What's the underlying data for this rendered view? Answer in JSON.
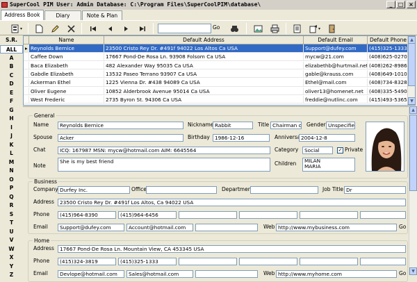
{
  "window": {
    "title": "SuperCool PIM    User: Admin  Database: C:\\Program Files\\SuperCoolPIM\\database\\"
  },
  "tabs": [
    "Address Book",
    "Diary",
    "Note & Plan"
  ],
  "toolbar": {
    "search_value": "",
    "go_label": "Go"
  },
  "az": {
    "header": "S.R.",
    "items": [
      "ALL",
      "A",
      "B",
      "C",
      "D",
      "E",
      "F",
      "G",
      "H",
      "I",
      "J",
      "K",
      "L",
      "M",
      "N",
      "O",
      "P",
      "Q",
      "R",
      "S",
      "T",
      "U",
      "V",
      "W",
      "X",
      "Y",
      "Z"
    ]
  },
  "grid": {
    "columns": [
      "Name",
      "Default Address",
      "Default Email",
      "Default Phone"
    ],
    "rows": [
      [
        "Reynolds Bernice",
        "23500 Cristo Rey Dr. #491f 94022 Los Altos Ca USA",
        "Support@dufey.com",
        "(415)325-1333"
      ],
      [
        "Caffee Down",
        "17667 Pond-De Rosa Ln. 93908 Folsom Ca USA",
        "mycw@21.com",
        "(408)625-0270"
      ],
      [
        "Baca Elizabeth",
        "482 Alexander Way 95035 Ca USA",
        "elizabethb@hurtmail.net",
        "(408)262-8986"
      ],
      [
        "Gabdle Elizabeth",
        "13532 Paseo Terrano 93907 Ca USA",
        "gable@krauss.com",
        "(408)649-1010"
      ],
      [
        "Ackerman Ethel",
        "1225 Vienna Dr. #438 94089 Ca USA",
        "Ethel@mail.com",
        "(408)734-8328"
      ],
      [
        "Oliver Eugene",
        "10852 Alderbrook Avenue 95014 Ca USA",
        "oliver13@homenet.net",
        "(408)335-5490"
      ],
      [
        "West Frederic",
        "2735 Byron St. 94306 Ca USA",
        "freddie@nutlinc.com",
        "(415)493-5365"
      ]
    ]
  },
  "general": {
    "group_label": "General",
    "name_label": "Name",
    "name": "Reynolds Bernice",
    "nickname_label": "Nickname",
    "nickname": "Rabbit",
    "title_label": "Title",
    "title": "Chairman of S",
    "gender_label": "Gender",
    "gender": "Unspecified",
    "spouse_label": "Spouse",
    "spouse": "Acker",
    "birthday_label": "Birthday",
    "birthday": "1986-12-16",
    "anniversary_label": "Anniversary",
    "anniversary": "2004-12-8",
    "chat_label": "Chat",
    "chat": "ICQ: 167987   MSN: mycw@hotmail.com   AIM: 6645564",
    "category_label": "Category",
    "category": "Social",
    "private_label": "Private",
    "private": "✓",
    "note_label": "Note",
    "note": "She is my best friend",
    "children_label": "Children",
    "children": [
      "MILAN",
      "MARIA"
    ]
  },
  "business": {
    "group_label": "Business",
    "company_label": "Company",
    "company": "Durfey Inc.",
    "office_label": "Office",
    "office": "",
    "department_label": "Department",
    "department": "",
    "jobtitle_label": "Job Title",
    "jobtitle": "Dr",
    "address_label": "Address",
    "address": "23500 Cristo Rey Dr. #491f  Los Altos, Ca 94022 USA",
    "phone_label": "Phone",
    "phone1": "(415)964-8390",
    "phone2": "(415)964-6456",
    "email_label": "Email",
    "email1": "Support@dufey.com",
    "email2": "Account@hotmail.com",
    "web_label": "Web",
    "web": "http://www.mybusiness.com",
    "go_label": "Go"
  },
  "home": {
    "group_label": "Home",
    "address_label": "Address",
    "address": "17667 Pond-De Rosa Ln.  Mountain View, CA 453345 USA",
    "phone_label": "Phone",
    "phone1": "(415)324-3819",
    "phone2": "(415)325-1333",
    "email_label": "Email",
    "email1": "Devlope@hotmail.com",
    "email2": "Sales@hotmail.com",
    "web_label": "Web",
    "web": "http://www.myhome.com",
    "go_label": "Go"
  }
}
